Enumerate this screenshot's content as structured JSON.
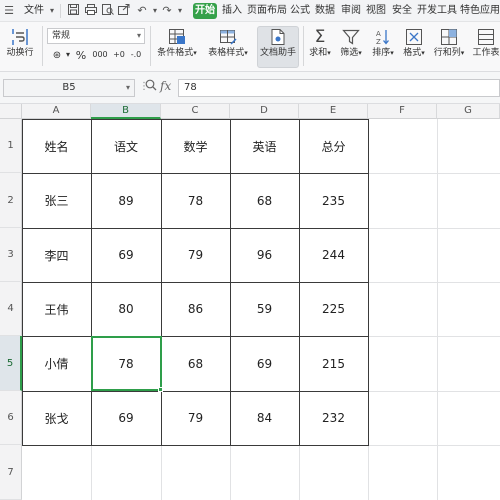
{
  "menubar": {
    "file_label": "文件",
    "start_tab": "开始",
    "tabs": [
      "插入",
      "页面布局",
      "公式",
      "数据",
      "审阅",
      "视图",
      "安全",
      "开发工具",
      "特色应用"
    ],
    "quick_icons": [
      "save-icon",
      "print-icon",
      "print-preview-icon",
      "export-icon",
      "undo-icon",
      "redo-icon"
    ]
  },
  "ribbon": {
    "wrap_label": "动换行",
    "number_format": "常规",
    "percent_symbol": "%",
    "thousands_symbol": "000",
    "decimal_increase": "+0",
    "decimal_decrease": "-.0",
    "conditional_label": "条件格式",
    "table_style_label": "表格样式",
    "doc_helper_label": "文档助手",
    "sum_label": "求和",
    "filter_label": "筛选",
    "sort_label": "排序",
    "format_label": "格式",
    "rowcol_label": "行和列",
    "worksheet_label": "工作表"
  },
  "formula_bar": {
    "cell_ref": "B5",
    "value": "78",
    "fx_label": "fx"
  },
  "columns": [
    "A",
    "B",
    "C",
    "D",
    "E",
    "F",
    "G"
  ],
  "selected_column": "B",
  "rows": [
    "1",
    "2",
    "3",
    "4",
    "5",
    "6",
    "7"
  ],
  "selected_row": "5",
  "table": {
    "headers": [
      "姓名",
      "语文",
      "数学",
      "英语",
      "总分"
    ],
    "data": [
      [
        "张三",
        "89",
        "78",
        "68",
        "235"
      ],
      [
        "李四",
        "69",
        "79",
        "96",
        "244"
      ],
      [
        "王伟",
        "80",
        "86",
        "59",
        "225"
      ],
      [
        "小倩",
        "78",
        "68",
        "69",
        "215"
      ],
      [
        "张戈",
        "69",
        "79",
        "84",
        "232"
      ]
    ]
  },
  "colors": {
    "accent": "#35a14a",
    "selection": "#2e9e4a"
  }
}
